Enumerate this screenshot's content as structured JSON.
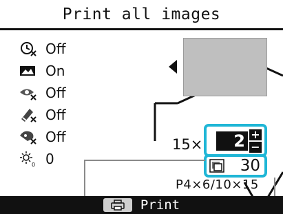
{
  "header": {
    "title": "Print all images"
  },
  "settings": [
    {
      "icon": "date-imprint-icon",
      "value": "Off"
    },
    {
      "icon": "image-optimize-icon",
      "value": "On"
    },
    {
      "icon": "red-eye-correction-icon",
      "value": "Off"
    },
    {
      "icon": "color-correction-icon",
      "value": "Off"
    },
    {
      "icon": "face-brightening-icon",
      "value": "Off"
    },
    {
      "icon": "brightness-icon",
      "value": "0"
    }
  ],
  "preview": {
    "nav_icon": "arrow-left-icon"
  },
  "quantity": {
    "prefix": "15×",
    "value": "2",
    "plus": "+",
    "minus": "−"
  },
  "sheet_count": {
    "icon": "print-count-icon",
    "value": "30"
  },
  "paper_size": {
    "label": "P4×6/10×15"
  },
  "footer": {
    "icon": "print-icon",
    "label": "Print"
  },
  "colors": {
    "highlight": "#1fb6d6",
    "bar": "#111111",
    "preview": "#bfbfbf"
  }
}
